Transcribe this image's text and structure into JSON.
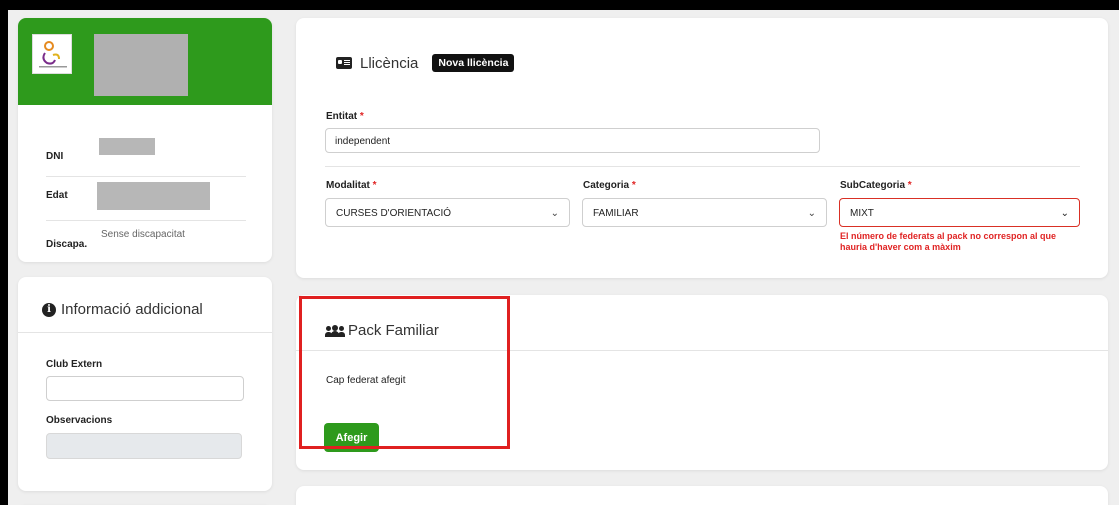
{
  "profile": {
    "dni_label": "DNI",
    "edat_label": "Edat",
    "discapa_label": "Discapa.",
    "discapa_value": "Sense discapacitat"
  },
  "info": {
    "title": "Informació addicional",
    "club_extern_label": "Club Extern",
    "club_extern_value": "",
    "observacions_label": "Observacions",
    "observacions_value": ""
  },
  "licence": {
    "title": "Llicència",
    "badge": "Nova llicència",
    "entitat_label": "Entitat",
    "entitat_value": "independent",
    "modalitat_label": "Modalitat",
    "modalitat_value": "CURSES D'ORIENTACIÓ",
    "categoria_label": "Categoria",
    "categoria_value": "FAMILIAR",
    "subcategoria_label": "SubCategoria",
    "subcategoria_value": "MIXT",
    "subcategoria_error": "El número de federats al pack no correspon al que hauria d'haver com a màxim",
    "required_mark": "*"
  },
  "pack": {
    "title": "Pack Familiar",
    "empty_text": "Cap federat afegit",
    "add_button": "Afegir"
  },
  "colors": {
    "brand_green": "#2e9a1c",
    "error_red": "#e02424",
    "highlight_red": "#e02020"
  },
  "icons": {
    "info": "info-circle-icon",
    "licence": "id-card-icon",
    "pack": "users-icon",
    "select": "chevron-down-icon"
  }
}
